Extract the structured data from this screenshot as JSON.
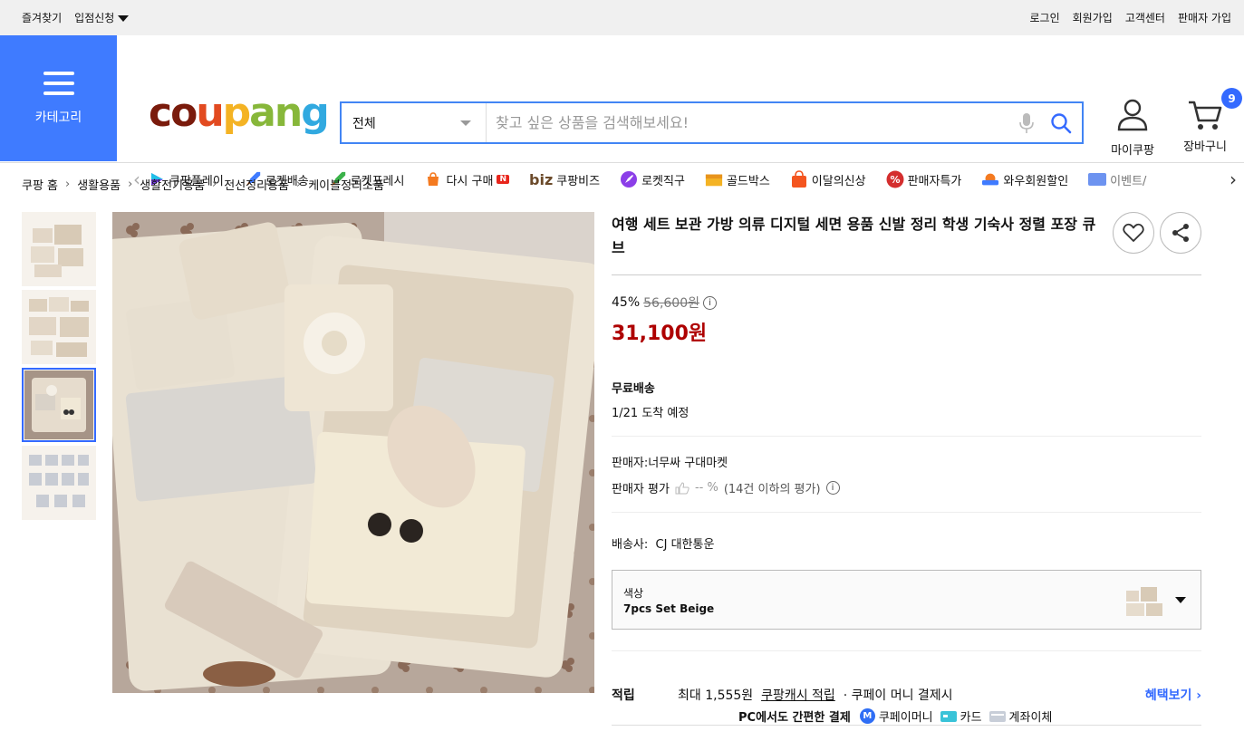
{
  "topbar": {
    "left": [
      "즐겨찾기",
      "입점신청"
    ],
    "right": [
      "로그인",
      "회원가입",
      "고객센터",
      "판매자 가입"
    ]
  },
  "category": {
    "label": "카테고리"
  },
  "logo": {
    "text": "coupang"
  },
  "search": {
    "scope": "전체",
    "placeholder": "찾고 싶은 상품을 검색해보세요!"
  },
  "mycoupang": {
    "label": "마이쿠팡"
  },
  "cart": {
    "label": "장바구니",
    "count": "9"
  },
  "nav": {
    "items": [
      {
        "label": "쿠팡플레이",
        "icon": "coupang-play-icon"
      },
      {
        "label": "로켓배송",
        "icon": "rocket-icon"
      },
      {
        "label": "로켓프레시",
        "icon": "rocket-fresh-icon"
      },
      {
        "label": "다시 구매",
        "icon": "rebuy-icon"
      },
      {
        "label": "쿠팡비즈",
        "icon": "biz-icon"
      },
      {
        "label": "로켓직구",
        "icon": "rocket-global-icon"
      },
      {
        "label": "골드박스",
        "icon": "goldbox-icon"
      },
      {
        "label": "이달의신상",
        "icon": "new-bag-icon"
      },
      {
        "label": "판매자특가",
        "icon": "percent-icon"
      },
      {
        "label": "와우회원할인",
        "icon": "wow-icon"
      },
      {
        "label": "이벤트/",
        "icon": "event-icon"
      }
    ]
  },
  "breadcrumb": [
    "쿠팡 홈",
    "생활용품",
    "생활전기용품",
    "전선정리용품",
    "케이블정리소품"
  ],
  "product": {
    "title": "여행 세트 보관 가방 의류 디지털 세면 용품 신발 정리 학생 기숙사 정렬 포장 큐브",
    "discount": "45%",
    "original_price": "56,600원",
    "price": "31,100원",
    "shipping": "무료배송",
    "arrival": "1/21 도착 예정",
    "seller": "판매자:너무싸 구대마켓",
    "seller_rating_label": "판매자 평가",
    "seller_rating_value": "-- %",
    "seller_rating_note": "(14건 이하의 평가)",
    "carrier": "배송사:  CJ 대한통운",
    "option_label": "색상",
    "option_value": "7pcs Set Beige",
    "points_label": "적립",
    "points_max": "최대 1,555원",
    "points_link": "쿠팡캐시 적립",
    "points_note": "· 쿠페이 머니 결제시",
    "benefit_link": "혜택보기",
    "pay_title": "PC에서도 간편한 결제",
    "pay_methods": [
      "쿠페이머니",
      "카드",
      "계좌이체"
    ]
  },
  "colors": {
    "accent": "#346aff",
    "category_bg": "#3f7bff",
    "price": "#ae0000"
  }
}
